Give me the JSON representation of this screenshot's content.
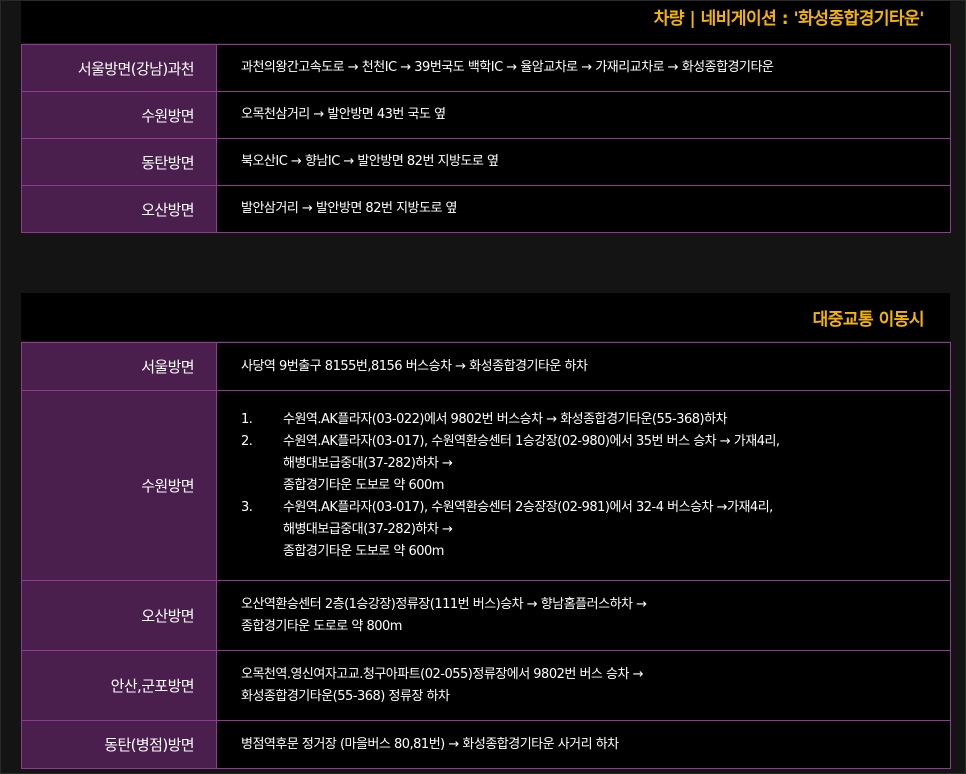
{
  "car": {
    "title": "차량 | 네비게이션 : '화성종합경기타운'",
    "rows": [
      {
        "label": "서울방면(강남)과천",
        "text": "과천의왕간고속도로 → 천천IC → 39번국도 백학IC → 율암교차로 → 가재리교차로 → 화성종합경기타운"
      },
      {
        "label": "수원방면",
        "text": "오목천삼거리 → 발안방면 43번 국도 옆"
      },
      {
        "label": "동탄방면",
        "text": "북오산IC → 향남IC → 발안방면 82번 지방도로 옆"
      },
      {
        "label": "오산방면",
        "text": "발안삼거리 → 발안방면 82번 지방도로 옆"
      }
    ]
  },
  "transit": {
    "title": "대중교통 이동시",
    "seoul": {
      "label": "서울방면",
      "text": "사당역 9번출구 8155번,8156 버스승차 → 화성종합경기타운 하차"
    },
    "suwon": {
      "label": "수원방면",
      "items": [
        {
          "num": "1.",
          "lines": [
            "수원역.AK플라자(03-022)에서 9802번 버스승차 → 화성종합경기타운(55-368)하차"
          ]
        },
        {
          "num": "2.",
          "lines": [
            "수원역.AK플라자(03-017), 수원역환승센터 1승강장(02-980)에서 35번 버스 승차 → 가재4리,",
            "해병대보급중대(37-282)하차 →",
            "종합경기타운 도보로 약 600m"
          ]
        },
        {
          "num": "3.",
          "lines": [
            "수원역.AK플라자(03-017), 수원역환승센터 2승장장(02-981)에서 32-4 버스승차 →가재4리,",
            "해병대보급중대(37-282)하차 →",
            "종합경기타운 도보로 약 600m"
          ]
        }
      ]
    },
    "osan": {
      "label": "오산방면",
      "lines": [
        "오산역환승센터 2층(1승강장)정류장(111번 버스)승차 → 향남홈플러스하차 →",
        "종합경기타운 도로로 약 800m"
      ]
    },
    "ansan": {
      "label": "안산,군포방면",
      "lines": [
        "오목천역.영신여자고교.청구아파트(02-055)정류장에서 9802번 버스 승차 →",
        "화성종합경기타운(55-368) 정류장 하차"
      ]
    },
    "dongtan": {
      "label": "동탄(병점)방면",
      "text": "병점역후문 정거장 (마을버스 80,81번) → 화성종합경기타운 사거리 하차"
    }
  },
  "colors": {
    "accent": "#f5b400",
    "label_bg": "#4a1f4d",
    "border": "#8e3a8e",
    "content_bg": "#000000"
  }
}
